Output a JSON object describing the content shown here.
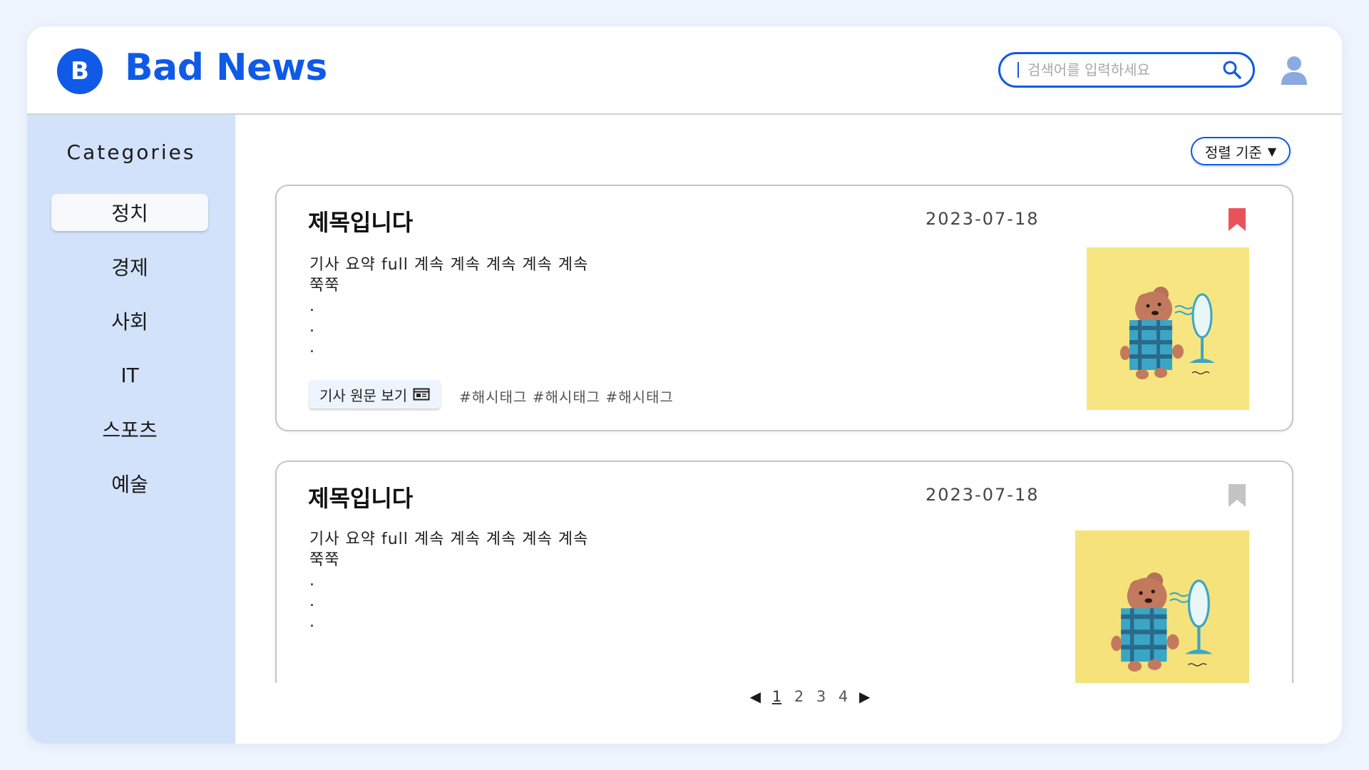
{
  "header": {
    "logo_letter": "B",
    "app_name": "Bad News",
    "search_placeholder": "검색어를 입력하세요"
  },
  "sidebar": {
    "title": "Categories",
    "items": [
      {
        "label": "정치",
        "active": true
      },
      {
        "label": "경제",
        "active": false
      },
      {
        "label": "사회",
        "active": false
      },
      {
        "label": "IT",
        "active": false
      },
      {
        "label": "스포츠",
        "active": false
      },
      {
        "label": "예술",
        "active": false
      }
    ]
  },
  "main": {
    "sort_label": "정렬 기준",
    "articles": [
      {
        "title": "제목입니다",
        "date": "2023-07-18",
        "bookmarked": true,
        "summary": "기사 요약 full 계속 계속 계속 계속 계속\n쭉쭉\n.\n.\n.",
        "original_button": "기사 원문 보기",
        "hashtags": "#해시태그 #해시태그 #해시태그"
      },
      {
        "title": "제목입니다",
        "date": "2023-07-18",
        "bookmarked": false,
        "summary": "기사 요약 full 계속 계속 계속 계속 계속\n쭉쭉\n.\n.\n."
      }
    ]
  },
  "pagination": {
    "pages": [
      "1",
      "2",
      "3",
      "4"
    ],
    "current": "1"
  },
  "colors": {
    "brand": "#0f5ae6",
    "sidebar_bg": "#d2e2fb",
    "bookmark_active": "#e8535b",
    "bookmark_inactive": "#c4c4c4",
    "thumbnail_bg": "#f6e27a"
  }
}
